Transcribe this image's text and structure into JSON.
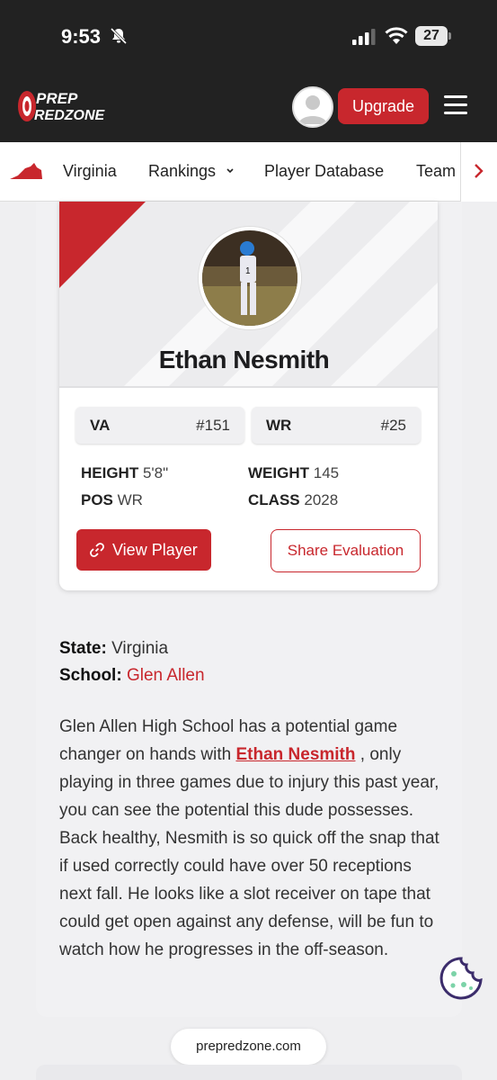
{
  "status_bar": {
    "time": "9:53",
    "battery": "27",
    "icons": [
      "bell-slash-icon",
      "signal-icon",
      "wifi-icon"
    ]
  },
  "header": {
    "logo_top": "PREP",
    "logo_bottom": "REDZONE",
    "upgrade_label": "Upgrade",
    "icons": [
      "avatar",
      "menu-icon"
    ]
  },
  "nav": {
    "items": [
      "Virginia",
      "Rankings",
      "Player Database",
      "Team"
    ],
    "icons": [
      "virginia-map-icon",
      "chevron-down-icon",
      "chevron-right-icon"
    ]
  },
  "player": {
    "name": "Ethan Nesmith",
    "state_rank": {
      "label": "VA",
      "value": "#151"
    },
    "position_rank": {
      "label": "WR",
      "value": "#25"
    },
    "height_label": "HEIGHT",
    "height": "5'8\"",
    "weight_label": "WEIGHT",
    "weight": "145",
    "pos_label": "POS",
    "pos": "WR",
    "class_label": "CLASS",
    "class": "2028"
  },
  "actions": {
    "view_player": "View Player",
    "share_evaluation": "Share Evaluation"
  },
  "details": {
    "state_label": "State:",
    "state": "Virginia",
    "school_label": "School:",
    "school": "Glen Allen"
  },
  "article": {
    "before": "Glen Allen High School has a potential game changer on hands with ",
    "name_link": "Ethan Nesmith",
    "after": " , only playing in three games due to injury this past year, you can see the potential this dude possesses. Back healthy, Nesmith is so quick off the snap that if used correctly could have over 50 receptions next fall. He looks like a slot receiver on tape that could get open against any defense, will be fun to watch how he progresses in the off-season."
  },
  "footer": {
    "url": "prepredzone.com"
  },
  "colors": {
    "brand_red": "#c8272d",
    "header_bg": "#222222"
  }
}
